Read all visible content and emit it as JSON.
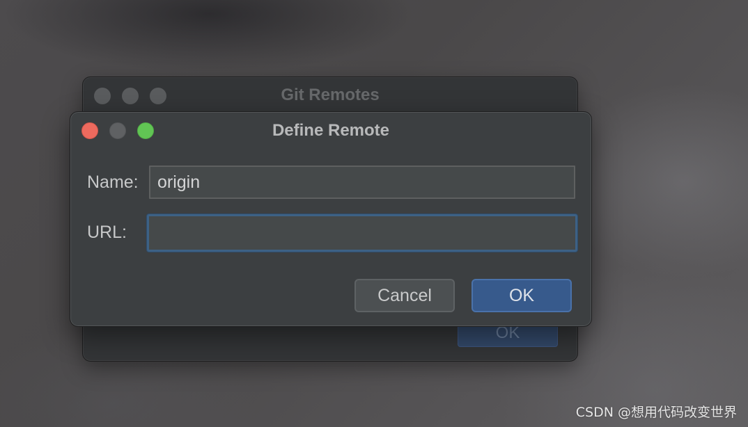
{
  "background_window": {
    "title": "Git Remotes",
    "ok_label": "OK"
  },
  "dialog": {
    "title": "Define Remote",
    "name_label": "Name:",
    "name_value": "origin",
    "url_label": "URL:",
    "url_value": "",
    "cancel_label": "Cancel",
    "ok_label": "OK"
  },
  "window_controls": [
    "close",
    "minimize",
    "maximize"
  ],
  "colors": {
    "close": "#ed6a5e",
    "minimize_inactive": "#5f6163",
    "maximize": "#61c554",
    "primary_button": "#375a8c",
    "focus_ring": "#3d6185",
    "dialog_background": "#3c3f41"
  },
  "watermark": "CSDN @想用代码改变世界"
}
